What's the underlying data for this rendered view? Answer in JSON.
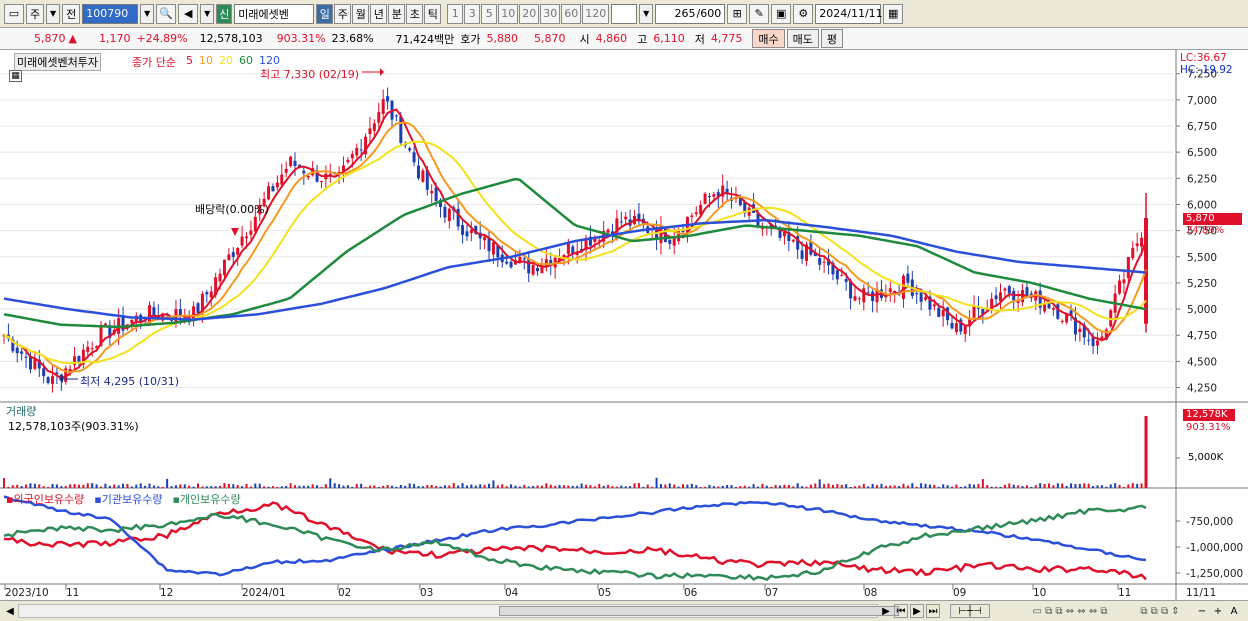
{
  "toolbar": {
    "period_label": "주",
    "market_label": "전",
    "code": "100790",
    "badge": "신",
    "stock_name": "미래에셋벤",
    "periods": [
      "일",
      "주",
      "월",
      "년",
      "분",
      "초",
      "틱"
    ],
    "active_period": "일",
    "intervals": [
      "1",
      "3",
      "5",
      "10",
      "20",
      "30",
      "60",
      "120"
    ],
    "count": "265",
    "count_total": "/600",
    "date": "2024/11/11"
  },
  "quote": {
    "price": "5,870",
    "arrow": "▲",
    "change": "1,170",
    "change_pct": "+24.89%",
    "volume": "12,578,103",
    "volume_pct": "903.31%",
    "turnover": "23.68%",
    "amount": "71,424백만",
    "ask_label": "호가",
    "ask": "5,880",
    "bid": "5,870",
    "open_label": "시",
    "open": "4,860",
    "high_label": "고",
    "high": "6,110",
    "low_label": "저",
    "low": "4,775",
    "buy_label": "매수",
    "sell_label": "매도",
    "eval_label": "평"
  },
  "price_panel": {
    "stock_tag": "미래에셋벤처투자",
    "ma_label": "종가 단순",
    "ma_periods": [
      "5",
      "10",
      "20",
      "60",
      "120"
    ],
    "ma_colors": [
      "#e0102a",
      "#f59a1f",
      "#f3e11b",
      "#1d8a3c",
      "#2b4fd8"
    ],
    "high_note": "최고 7,330 (02/19)",
    "low_note": "최저 4,295 (10/31)",
    "dividend_note": "배당락(0.00%)",
    "lc": "LC:36.67",
    "hc": "HC:-19.92",
    "price_tag": "5,870",
    "pct_tag": "24.89%",
    "yticks": [
      "7,250",
      "7,000",
      "6,750",
      "6,500",
      "6,250",
      "6,000",
      "5,750",
      "5,500",
      "5,250",
      "5,000",
      "4,750",
      "4,500",
      "4,250"
    ]
  },
  "volume_panel": {
    "title": "거래량",
    "value": "12,578,103주(903.31%)",
    "tag": "12,578K",
    "tag_pct": "903.31%",
    "ytick": "5,000K"
  },
  "holding_panel": {
    "labels": [
      "외국인보유수량",
      "기관보유수량",
      "개인보유수량"
    ],
    "colors": [
      "#e0102a",
      "#2b4fd8",
      "#2e8b57"
    ],
    "yticks": [
      "-750,000",
      "-1,000,000",
      "-1,250,000"
    ]
  },
  "xaxis": {
    "labels": [
      "2023/10",
      "11",
      "12",
      "2024/01",
      "02",
      "03",
      "04",
      "05",
      "06",
      "07",
      "08",
      "09",
      "10",
      "11"
    ],
    "right_label": "11/11"
  },
  "chart_data": {
    "type": "candlestick",
    "title": "미래에셋벤처투자",
    "date_range": [
      "2023/10",
      "2024/11/11"
    ],
    "ylim": [
      4150,
      7400
    ],
    "last_close": 5870,
    "high": {
      "value": 7330,
      "date": "02/19"
    },
    "low": {
      "value": 4295,
      "date": "10/31"
    },
    "close_path": [
      {
        "date": "2023-10",
        "value": 4750
      },
      {
        "date": "2023-10-31",
        "value": 4300
      },
      {
        "date": "2023-11",
        "value": 4750
      },
      {
        "date": "2023-12",
        "value": 4950
      },
      {
        "date": "2023-12-late",
        "value": 4950
      },
      {
        "date": "2024-01-early",
        "value": 5700
      },
      {
        "date": "2024-01",
        "value": 6400
      },
      {
        "date": "2024-02",
        "value": 6200
      },
      {
        "date": "2024-02-19",
        "value": 7000
      },
      {
        "date": "2024-03",
        "value": 6050
      },
      {
        "date": "2024-04",
        "value": 5650
      },
      {
        "date": "2024-04-late",
        "value": 5400
      },
      {
        "date": "2024-05",
        "value": 5600
      },
      {
        "date": "2024-05-late",
        "value": 5850
      },
      {
        "date": "2024-06",
        "value": 5700
      },
      {
        "date": "2024-06-late",
        "value": 6150
      },
      {
        "date": "2024-07",
        "value": 5750
      },
      {
        "date": "2024-07-late",
        "value": 5500
      },
      {
        "date": "2024-08",
        "value": 5100
      },
      {
        "date": "2024-08-late",
        "value": 5250
      },
      {
        "date": "2024-09",
        "value": 4800
      },
      {
        "date": "2024-09-late",
        "value": 5200
      },
      {
        "date": "2024-10",
        "value": 5050
      },
      {
        "date": "2024-10-late",
        "value": 4650
      },
      {
        "date": "2024-11-11",
        "value": 5870
      }
    ],
    "ma60": [
      4950,
      4850,
      4830,
      4870,
      4950,
      5100,
      5550,
      5900,
      6100,
      6250,
      5800,
      5650,
      5700,
      5800,
      5750,
      5700,
      5600,
      5350,
      5250,
      5100,
      5000
    ],
    "ma120": [
      5100,
      5000,
      4920,
      4900,
      4950,
      5050,
      5200,
      5400,
      5500,
      5650,
      5750,
      5820,
      5850,
      5780,
      5700,
      5550,
      5450,
      5400,
      5350
    ],
    "last_volume": 12578103
  }
}
